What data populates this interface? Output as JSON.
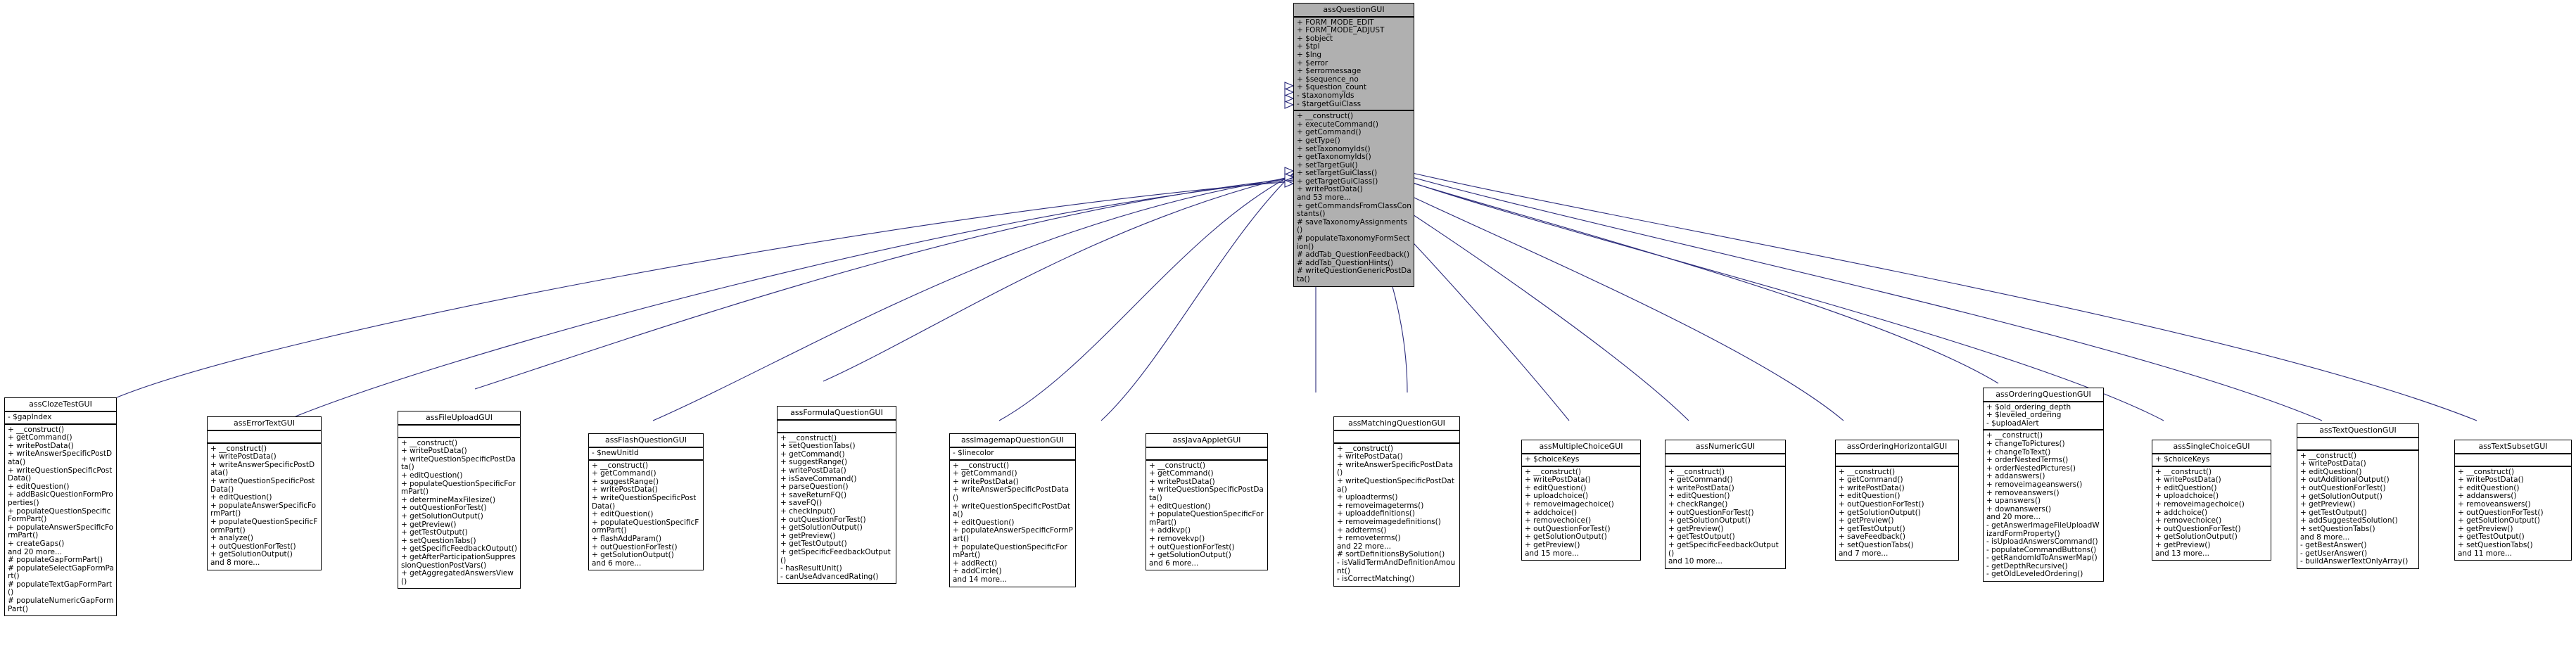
{
  "diagram": {
    "type": "uml-class-inheritance",
    "title": "assQuestionGUI class hierarchy",
    "root_fill_color": "#b0b0b0",
    "edge_color": "#2a2a7a",
    "box_border_color": "#000000",
    "box_fill_color": "#ffffff"
  },
  "root": {
    "name": "assQuestionGUI",
    "attributes": [
      "+ FORM_MODE_EDIT",
      "+ FORM_MODE_ADJUST",
      "+ $object",
      "+ $tpl",
      "+ $lng",
      "+ $error",
      "+ $errormessage",
      "+ $sequence_no",
      "+ $question_count",
      "- $taxonomyIds",
      "- $targetGuiClass"
    ],
    "operations": [
      "+ __construct()",
      "+ executeCommand()",
      "+ getCommand()",
      "+ getType()",
      "+ setTaxonomyIds()",
      "+ getTaxonomyIds()",
      "+ setTargetGui()",
      "+ setTargetGuiClass()",
      "+ getTargetGuiClass()",
      "+ writePostData()",
      "and 53 more...",
      "+ getCommandsFromClassConstants()",
      "# saveTaxonomyAssignments()",
      "# populateTaxonomyFormSection()",
      "# addTab_QuestionFeedback()",
      "# addTab_QuestionHints()",
      "# writeQuestionGenericPostData()"
    ]
  },
  "subclasses": [
    {
      "name": "assClozeTestGUI",
      "attributes": [
        "- $gapIndex"
      ],
      "operations": [
        "+ __construct()",
        "+ getCommand()",
        "+ writePostData()",
        "+ writeAnswerSpecificPostData()",
        "+ writeQuestionSpecificPostData()",
        "+ editQuestion()",
        "+ addBasicQuestionFormProperties()",
        "+ populateQuestionSpecificFormPart()",
        "+ populateAnswerSpecificFormPart()",
        "+ createGaps()",
        "and 20 more...",
        "# populateGapFormPart()",
        "# populateSelectGapFormPart()",
        "# populateTextGapFormPart()",
        "# populateNumericGapFormPart()"
      ]
    },
    {
      "name": "assErrorTextGUI",
      "attributes": [],
      "operations": [
        "+ __construct()",
        "+ writePostData()",
        "+ writeAnswerSpecificPostData()",
        "+ writeQuestionSpecificPostData()",
        "+ editQuestion()",
        "+ populateAnswerSpecificFormPart()",
        "+ populateQuestionSpecificFormPart()",
        "+ analyze()",
        "+ outQuestionForTest()",
        "+ getSolutionOutput()",
        "and 8 more..."
      ]
    },
    {
      "name": "assFileUploadGUI",
      "attributes": [],
      "operations": [
        "+ __construct()",
        "+ writePostData()",
        "+ writeQuestionSpecificPostData()",
        "+ editQuestion()",
        "+ populateQuestionSpecificFormPart()",
        "+ determineMaxFilesize()",
        "+ outQuestionForTest()",
        "+ getSolutionOutput()",
        "+ getPreview()",
        "+ getTestOutput()",
        "+ setQuestionTabs()",
        "+ getSpecificFeedbackOutput()",
        "+ getAfterParticipationSuppressionQuestionPostVars()",
        "+ getAggregatedAnswersView()"
      ]
    },
    {
      "name": "assFlashQuestionGUI",
      "attributes": [
        "- $newUnitId"
      ],
      "operations": [
        "+ __construct()",
        "+ getCommand()",
        "+ suggestRange()",
        "+ writePostData()",
        "+ writeQuestionSpecificPostData()",
        "+ editQuestion()",
        "+ populateQuestionSpecificFormPart()",
        "+ flashAddParam()",
        "+ outQuestionForTest()",
        "+ getSolutionOutput()",
        "and 6 more..."
      ]
    },
    {
      "name": "assFormulaQuestionGUI",
      "attributes": [],
      "operations": [
        "+ __construct()",
        "+ setQuestionTabs()",
        "+ getCommand()",
        "+ suggestRange()",
        "+ writePostData()",
        "+ isSaveCommand()",
        "+ parseQuestion()",
        "+ saveReturnFQ()",
        "+ saveFQ()",
        "+ checkInput()",
        "+ outQuestionForTest()",
        "+ getSolutionOutput()",
        "+ getPreview()",
        "+ getTestOutput()",
        "+ getSpecificFeedbackOutput()",
        "- hasResultUnit()",
        "- canUseAdvancedRating()"
      ]
    },
    {
      "name": "assImagemapQuestionGUI",
      "attributes": [
        "- $linecolor"
      ],
      "operations": [
        "+ __construct()",
        "+ getCommand()",
        "+ writePostData()",
        "+ writeAnswerSpecificPostData()",
        "+ writeQuestionSpecificPostData()",
        "+ editQuestion()",
        "+ populateAnswerSpecificFormPart()",
        "+ populateQuestionSpecificFormPart()",
        "+ addRect()",
        "+ addCircle()",
        "and 14 more..."
      ]
    },
    {
      "name": "assJavaAppletGUI",
      "attributes": [],
      "operations": [
        "+ __construct()",
        "+ getCommand()",
        "+ writePostData()",
        "+ writeQuestionSpecificPostData()",
        "+ editQuestion()",
        "+ populateQuestionSpecificFormPart()",
        "+ addkvp()",
        "+ removekvp()",
        "+ outQuestionForTest()",
        "+ getSolutionOutput()",
        "and 6 more..."
      ]
    },
    {
      "name": "assMatchingQuestionGUI",
      "attributes": [],
      "operations": [
        "+ __construct()",
        "+ writePostData()",
        "+ writeAnswerSpecificPostData()",
        "+ writeQuestionSpecificPostData()",
        "+ uploadterms()",
        "+ removeimageterms()",
        "+ uploaddefinitions()",
        "+ removeimagedefinitions()",
        "+ addterms()",
        "+ removeterms()",
        "and 22 more...",
        "# sortDefinitionsBySolution()",
        "- isValidTermAndDefinitionAmount()",
        "- isCorrectMatching()"
      ]
    },
    {
      "name": "assMultipleChoiceGUI",
      "attributes": [
        "+ $choiceKeys"
      ],
      "operations": [
        "+ __construct()",
        "+ writePostData()",
        "+ editQuestion()",
        "+ uploadchoice()",
        "+ removeimagechoice()",
        "+ addchoice()",
        "+ removechoice()",
        "+ outQuestionForTest()",
        "+ getSolutionOutput()",
        "+ getPreview()",
        "and 15 more..."
      ]
    },
    {
      "name": "assNumericGUI",
      "attributes": [],
      "operations": [
        "+ __construct()",
        "+ getCommand()",
        "+ writePostData()",
        "+ editQuestion()",
        "+ checkRange()",
        "+ outQuestionForTest()",
        "+ getSolutionOutput()",
        "+ getPreview()",
        "+ getTestOutput()",
        "+ getSpecificFeedbackOutput()",
        "and 10 more..."
      ]
    },
    {
      "name": "assOrderingHorizontalGUI",
      "attributes": [],
      "operations": [
        "+ __construct()",
        "+ getCommand()",
        "+ writePostData()",
        "+ editQuestion()",
        "+ outQuestionForTest()",
        "+ getSolutionOutput()",
        "+ getPreview()",
        "+ getTestOutput()",
        "+ saveFeedback()",
        "+ setQuestionTabs()",
        "and 7 more..."
      ]
    },
    {
      "name": "assOrderingQuestionGUI",
      "attributes": [
        "+ $old_ordering_depth",
        "+ $leveled_ordering",
        "- $uploadAlert"
      ],
      "operations": [
        "+ __construct()",
        "+ changeToPictures()",
        "+ changeToText()",
        "+ orderNestedTerms()",
        "+ orderNestedPictures()",
        "+ addanswers()",
        "+ removeimageanswers()",
        "+ removeanswers()",
        "+ upanswers()",
        "+ downanswers()",
        "and 20 more...",
        "- getAnswerImageFileUploadWizardFormProperty()",
        "- isUploadAnswersCommand()",
        "- populateCommandButtons()",
        "- getRandomIdToAnswerMap()",
        "- getDepthRecursive()",
        "- getOldLeveledOrdering()"
      ]
    },
    {
      "name": "assSingleChoiceGUI",
      "attributes": [
        "+ $choiceKeys"
      ],
      "operations": [
        "+ __construct()",
        "+ writePostData()",
        "+ editQuestion()",
        "+ uploadchoice()",
        "+ removeimagechoice()",
        "+ addchoice()",
        "+ removechoice()",
        "+ outQuestionForTest()",
        "+ getSolutionOutput()",
        "+ getPreview()",
        "and 13 more..."
      ]
    },
    {
      "name": "assTextQuestionGUI",
      "attributes": [],
      "operations": [
        "+ __construct()",
        "+ writePostData()",
        "+ editQuestion()",
        "+ outAdditionalOutput()",
        "+ outQuestionForTest()",
        "+ getSolutionOutput()",
        "+ getPreview()",
        "+ getTestOutput()",
        "+ addSuggestedSolution()",
        "+ setQuestionTabs()",
        "and 8 more...",
        "- getBestAnswer()",
        "- getUserAnswer()",
        "- buildAnswerTextOnlyArray()"
      ]
    },
    {
      "name": "assTextSubsetGUI",
      "attributes": [],
      "operations": [
        "+ __construct()",
        "+ writePostData()",
        "+ editQuestion()",
        "+ addanswers()",
        "+ removeanswers()",
        "+ outQuestionForTest()",
        "+ getSolutionOutput()",
        "+ getPreview()",
        "+ getTestOutput()",
        "+ setQuestionTabs()",
        "and 11 more..."
      ]
    }
  ]
}
